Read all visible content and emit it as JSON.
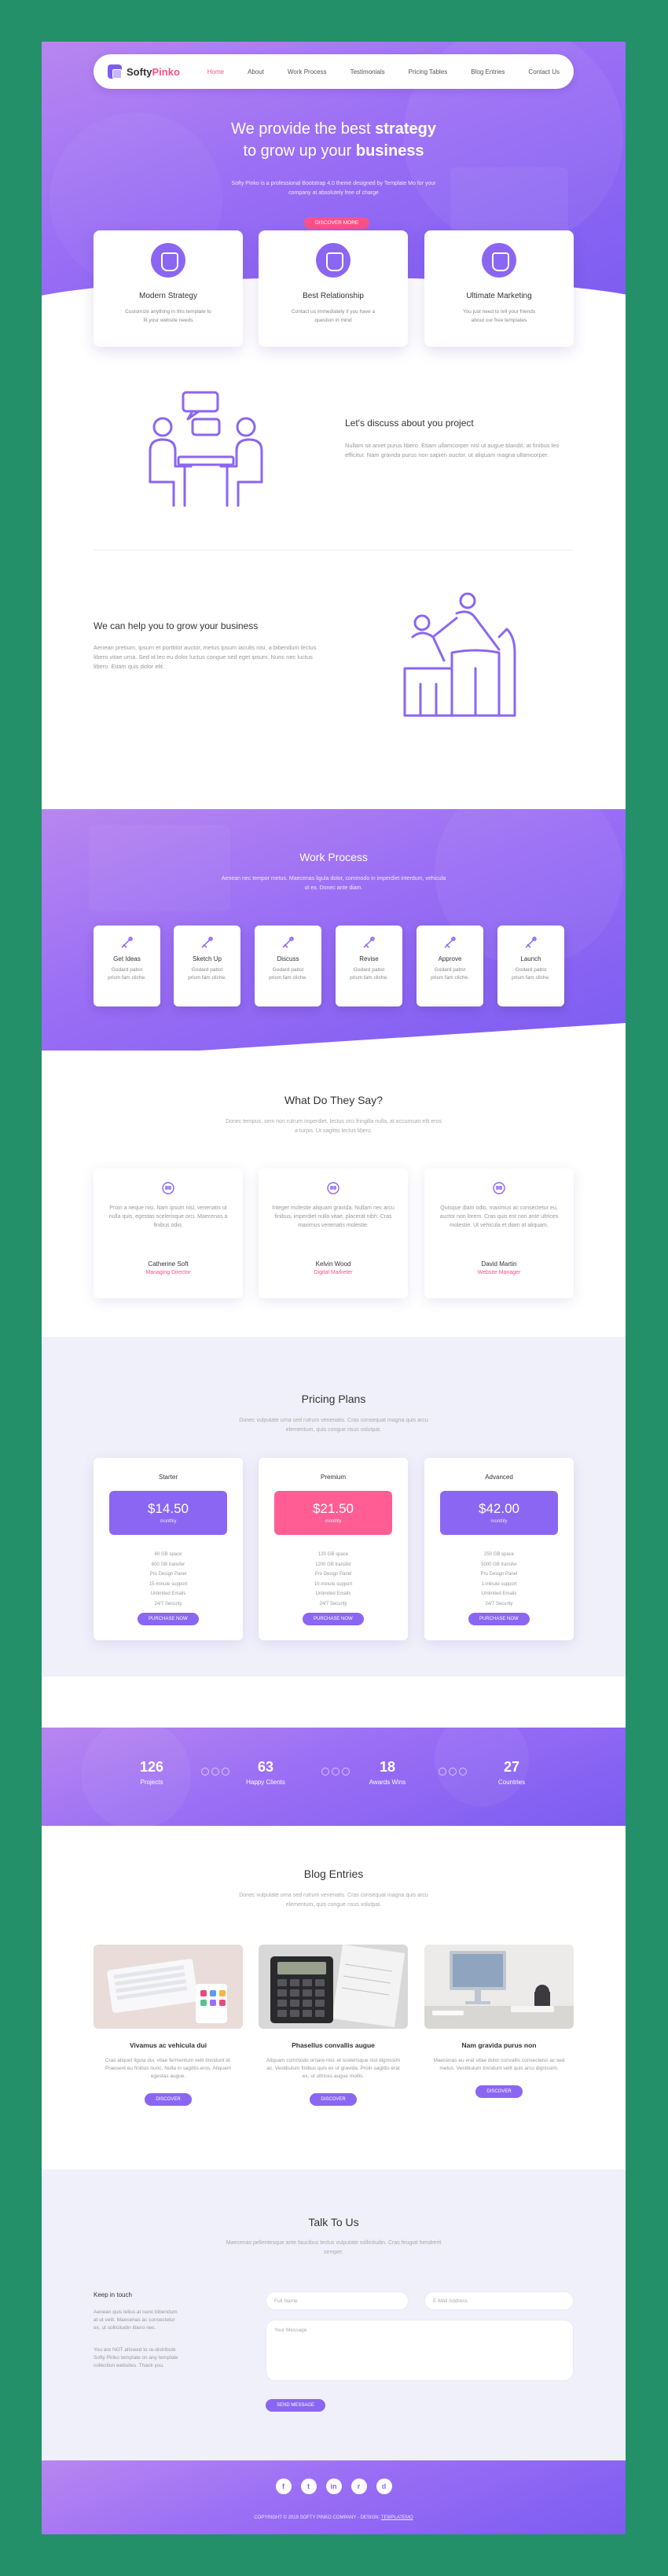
{
  "brand": {
    "name_part1": "Softy",
    "name_part2": "Pinko"
  },
  "nav": {
    "items": [
      "Home",
      "About",
      "Work Process",
      "Testimonials",
      "Pricing Tables",
      "Blog Entries",
      "Contact Us"
    ]
  },
  "hero": {
    "title_line1_pre": "We provide the best ",
    "title_line1_bold": "strategy",
    "title_line2_pre": "to grow up your ",
    "title_line2_bold": "business",
    "text": "Softy Pinko is a professional Bootstrap 4.0 theme designed by Template Mo for your company at absolutely free of charge",
    "button": "DISCOVER MORE"
  },
  "features": [
    {
      "icon": "strategy-icon",
      "title": "Modern Strategy",
      "text": "Customize anything in this template to fit your website needs"
    },
    {
      "icon": "relationship-icon",
      "title": "Best Relationship",
      "text": "Contact us immediately if you have a question in mind"
    },
    {
      "icon": "marketing-icon",
      "title": "Ultimate Marketing",
      "text": "You just need to tell your friends about our free templates"
    }
  ],
  "about1": {
    "title": "Let's discuss about you project",
    "text": "Nullam sit amet purus libero. Etiam ullamcorper nisl ut augue blandit, at finibus leo efficitur. Nam gravida purus non sapien auctor, ut aliquam magna ullamcorper."
  },
  "about2": {
    "title": "We can help you to grow your business",
    "text": "Aenean pretium, ipsum et porttitor auctor, metus ipsum iaculis nisi, a bibendum lectus libero vitae urna. Sed id leo eu dolor luctus congue sed eget ipsum. Nunc nec luctus libero. Etiam quis dolor elit."
  },
  "work": {
    "title": "Work Process",
    "subtitle": "Aenean nec tempor metus. Maecenas ligula dolor, commodo in imperdiet interdum, vehicula ut ex. Donec ante diam.",
    "steps": [
      {
        "icon": "idea-icon",
        "title": "Get Ideas",
        "text": "Godard pabst prism fam cliche."
      },
      {
        "icon": "sketch-icon",
        "title": "Sketch Up",
        "text": "Godard pabst prism fam cliche."
      },
      {
        "icon": "discuss-icon",
        "title": "Discuss",
        "text": "Godard pabst prism fam cliche."
      },
      {
        "icon": "revise-icon",
        "title": "Revise",
        "text": "Godard pabst prism fam cliche."
      },
      {
        "icon": "approve-icon",
        "title": "Approve",
        "text": "Godard pabst prism fam cliche."
      },
      {
        "icon": "launch-icon",
        "title": "Launch",
        "text": "Godard pabst prism fam cliche."
      }
    ]
  },
  "testimonials": {
    "title": "What Do They Say?",
    "subtitle": "Donec tempus, sem non rutrum imperdiet, lectus orci fringilla nulla, at accumsan elit eros a turpis. Ut sagittis lectus libero.",
    "items": [
      {
        "text": "Proin a neque nisi. Nam ipsum nisi, venenatis ut nulla quis, egestas scelerisque orci. Maecenas a finibus odio.",
        "name": "Catherine Soft",
        "role": "Managing Director"
      },
      {
        "text": "Integer molestie aliquam gravida. Nullam nec arcu finibus, imperdiet nulla vitae, placerat nibh. Cras maximus venenatis molestie.",
        "name": "Kelvin Wood",
        "role": "Digital Marketer"
      },
      {
        "text": "Quisque diam odio, maximus ac consectetur eu, auctor non lorem. Cras quis est non ante ultrices molestie. Ut vehicula et diam at aliquam.",
        "name": "David Martin",
        "role": "Website Manager"
      }
    ]
  },
  "pricing": {
    "title": "Pricing Plans",
    "subtitle": "Donec vulputate urna sed rutrum venenatis. Cras consequat magna quis arcu elementum, quis congue risus volutpat.",
    "plans": [
      {
        "name": "Starter",
        "price": "$14.50",
        "period": "monthly",
        "features": [
          "60 GB space",
          "600 GB transfer",
          "Pro Design Panel",
          "15-minute support",
          "Unlimited Emails",
          "24/7 Security"
        ],
        "button": "PURCHASE NOW"
      },
      {
        "name": "Premium",
        "price": "$21.50",
        "period": "monthly",
        "features": [
          "120 GB space",
          "1200 GB transfer",
          "Pro Design Panel",
          "10-minute support",
          "Unlimited Emails",
          "24/7 Security"
        ],
        "button": "PURCHASE NOW"
      },
      {
        "name": "Advanced",
        "price": "$42.00",
        "period": "monthly",
        "features": [
          "250 GB space",
          "5000 GB transfer",
          "Pro Design Panel",
          "1-minute support",
          "Unlimited Emails",
          "24/7 Security"
        ],
        "button": "PURCHASE NOW"
      }
    ]
  },
  "stats": [
    {
      "value": "126",
      "label": "Projects"
    },
    {
      "value": "63",
      "label": "Happy Clients"
    },
    {
      "value": "18",
      "label": "Awards Wins"
    },
    {
      "value": "27",
      "label": "Countries"
    }
  ],
  "blog": {
    "title": "Blog Entries",
    "subtitle": "Donec vulputate urna sed rutrum venenatis. Cras consequat magna quis arcu elementum, quis congue risus volutpat.",
    "posts": [
      {
        "title": "Vivamus ac vehicula dui",
        "text": "Cras aliquet ligula dui, vitae fermentum velit tincidunt id. Praesent eu finibus nunc. Nulla in sagittis eros. Aliquam egestas augue.",
        "button": "DISCOVER"
      },
      {
        "title": "Phasellus convallis augue",
        "text": "Aliquam commodo ornare nisl, et scelerisque nisl dignissim ac. Vestibulum finibus quis ex ut gravida. Proin sagittis erat ex, ut ultrices augue mollis.",
        "button": "DISCOVER"
      },
      {
        "title": "Nam gravida purus non",
        "text": "Maecenas eu erat vitae dolor convallis consectetur ac sed metus. Vestibulum tincidunt velit quis arcu dignissim.",
        "button": "DISCOVER"
      }
    ]
  },
  "contact": {
    "title": "Talk To Us",
    "subtitle": "Maecenas pellentesque ante faucibus lectus vulputate sollicitudin. Cras feugiat hendrerit semper.",
    "keep_title": "Keep in touch",
    "keep_text1": "Aenean quis tellus at nunc bibendum at ut velit. Maecenas ac consectetur ex, ut sollicitudin libero nec.",
    "keep_text2": "You are NOT allowed to re-distribute Softy Pinko template on any template collection websites. Thank you.",
    "name_placeholder": "Full Name",
    "email_placeholder": "E-Mail Address",
    "message_placeholder": "Your Message",
    "button": "SEND MESSAGE"
  },
  "footer": {
    "social": [
      "f",
      "t",
      "in",
      "r",
      "d"
    ],
    "copyright": "COPYRIGHT © 2019 SOFTY PINKO COMPANY - DESIGN: ",
    "design_link": "TEMPLATEMO"
  },
  "colors": {
    "purple": "#8b66f2",
    "pink": "#ff4f8b",
    "frame": "#23906a"
  }
}
